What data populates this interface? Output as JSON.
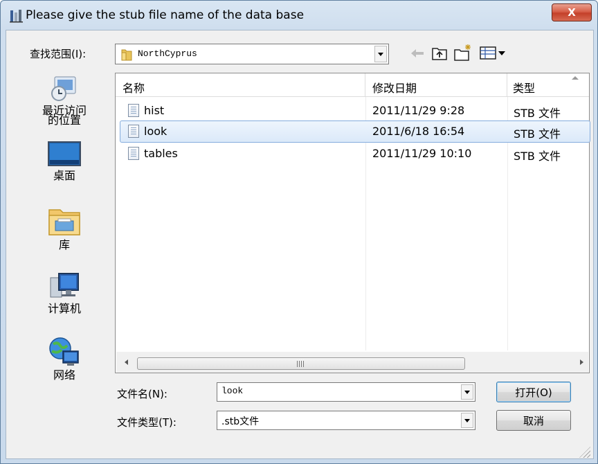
{
  "window": {
    "title": "Please give the stub file name of the data base",
    "close_label": "X"
  },
  "lookin": {
    "label": "查找范围(I):",
    "value": "NorthCyprus",
    "toolbar_icons": [
      "back-arrow-icon",
      "up-folder-icon",
      "new-folder-icon",
      "view-menu-icon"
    ]
  },
  "places": [
    {
      "label": "最近访问的位置",
      "icon": "recent-places-icon"
    },
    {
      "label": "桌面",
      "icon": "desktop-icon"
    },
    {
      "label": "库",
      "icon": "libraries-icon"
    },
    {
      "label": "计算机",
      "icon": "computer-icon"
    },
    {
      "label": "网络",
      "icon": "network-icon"
    }
  ],
  "columns": {
    "name": "名称",
    "modified": "修改日期",
    "type": "类型"
  },
  "files": [
    {
      "name": "hist",
      "modified": "2011/11/29 9:28",
      "type": "STB 文件"
    },
    {
      "name": "look",
      "modified": "2011/6/18 16:54",
      "type": "STB 文件",
      "selected": true
    },
    {
      "name": "tables",
      "modified": "2011/11/29 10:10",
      "type": "STB 文件"
    }
  ],
  "filename": {
    "label": "文件名(N):",
    "value": "look"
  },
  "filetype": {
    "label": "文件类型(T):",
    "value": ".stb文件"
  },
  "buttons": {
    "open": "打开(O)",
    "cancel": "取消"
  }
}
